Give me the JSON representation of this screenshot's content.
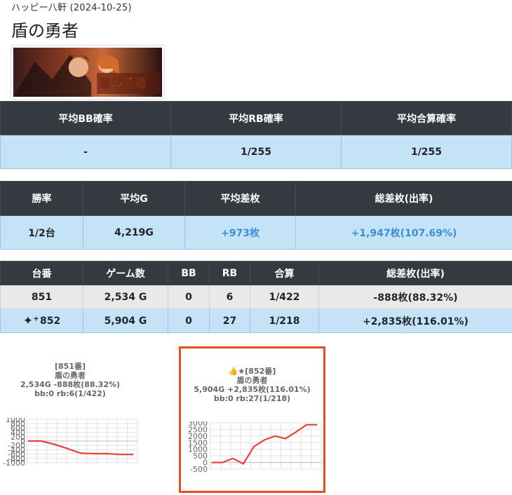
{
  "store_line": "ハッピー八軒 (2024-10-25)",
  "machine_name": "盾の勇者",
  "summary1": {
    "headers": [
      "平均BB確率",
      "平均RB確率",
      "平均合算確率"
    ],
    "values": [
      "-",
      "1/255",
      "1/255"
    ]
  },
  "summary2": {
    "headers": [
      "勝率",
      "平均G",
      "平均差枚",
      "総差枚(出率)"
    ],
    "values": [
      "1/2台",
      "4,219G",
      "+973枚",
      "+1,947枚(107.69%)"
    ]
  },
  "machines": {
    "headers": [
      "台番",
      "ゲーム数",
      "BB",
      "RB",
      "合算",
      "総差枚(出率)"
    ],
    "rows": [
      {
        "num": "851",
        "games": "2,534 G",
        "bb": "0",
        "rb": "6",
        "total": "1/422",
        "diff": "-888枚(88.32%)",
        "highlight": false
      },
      {
        "num": "852",
        "games": "5,904 G",
        "bb": "0",
        "rb": "27",
        "total": "1/218",
        "diff": "+2,835枚(116.01%)",
        "highlight": true,
        "icon": "sparkle-icon"
      }
    ]
  },
  "graphs": [
    {
      "head": [
        "[851番]",
        "盾の勇者",
        "2,534G -888枚(88.32%)",
        "bb:0 rb:6(1/422)"
      ],
      "y_ticks": [
        "1000",
        "800",
        "600",
        "400",
        "200",
        "0",
        "-200",
        "-400",
        "-600",
        "-800",
        "-1000"
      ],
      "chart_data": {
        "type": "line",
        "ylim": [
          -1000,
          1000
        ],
        "values": [
          0,
          0,
          -150,
          -350,
          -560,
          -580,
          -580,
          -620,
          -620
        ],
        "color": "#e8423a"
      }
    },
    {
      "head": [
        "👍★[852番]",
        "盾の勇者",
        "5,904G +2,835枚(116.01%)",
        "bb:0 rb:27(1/218)"
      ],
      "y_ticks": [
        "3000",
        "2500",
        "2000",
        "1500",
        "1000",
        "500",
        "0",
        "-500"
      ],
      "chart_data": {
        "type": "line",
        "ylim": [
          -500,
          3000
        ],
        "values": [
          0,
          0,
          300,
          -100,
          1200,
          1700,
          2000,
          1800,
          2300,
          2850,
          2850
        ],
        "color": "#e8423a"
      }
    }
  ],
  "colors": {
    "header_bg": "#343a40",
    "row_highlight": "#c5e3f7",
    "positive": "#3b8fd6",
    "line": "#e8423a",
    "card_border": "#e2501c"
  }
}
